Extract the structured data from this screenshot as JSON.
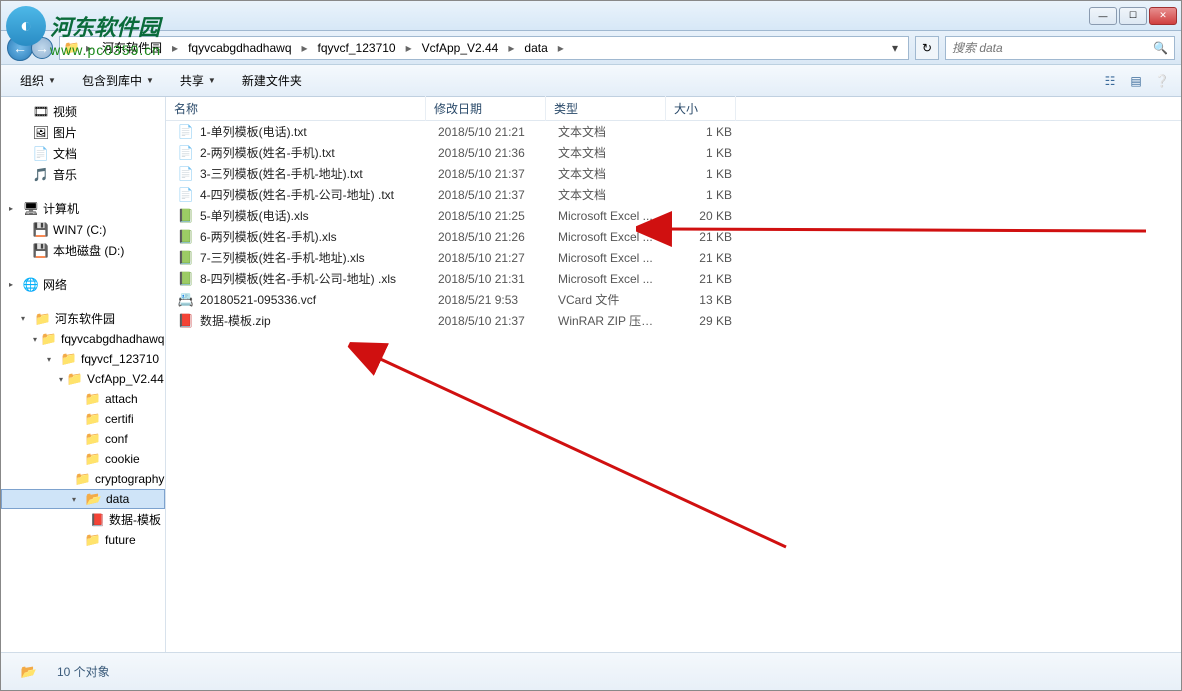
{
  "window": {
    "breadcrumb": [
      {
        "label": "河东软件园"
      },
      {
        "label": "fqyvcabgdhadhawq"
      },
      {
        "label": "fqyvcf_123710"
      },
      {
        "label": "VcfApp_V2.44"
      },
      {
        "label": "data"
      }
    ],
    "search_placeholder": "搜索 data"
  },
  "toolbar": {
    "organize": "组织",
    "include": "包含到库中",
    "share": "共享",
    "new_folder": "新建文件夹"
  },
  "columns": {
    "name": "名称",
    "date": "修改日期",
    "type": "类型",
    "size": "大小"
  },
  "nav": {
    "libraries": [
      {
        "label": "视频",
        "icon": "video-ico"
      },
      {
        "label": "图片",
        "icon": "pic-ico"
      },
      {
        "label": "文档",
        "icon": "doc-ico"
      },
      {
        "label": "音乐",
        "icon": "music-ico"
      }
    ],
    "computer_label": "计算机",
    "drives": [
      {
        "label": "WIN7 (C:)",
        "icon": "drive-ico"
      },
      {
        "label": "本地磁盘 (D:)",
        "icon": "drive-ico"
      }
    ],
    "network_label": "网络",
    "tree": [
      {
        "label": "河东软件园",
        "depth": 0,
        "icon": "folder-ico",
        "tri": "▾"
      },
      {
        "label": "fqyvcabgdhadhawq",
        "depth": 1,
        "icon": "folder-ico",
        "tri": "▾"
      },
      {
        "label": "fqyvcf_123710",
        "depth": 2,
        "icon": "folder-ico",
        "tri": "▾"
      },
      {
        "label": "VcfApp_V2.44",
        "depth": 3,
        "icon": "folder-ico",
        "tri": "▾"
      },
      {
        "label": "attach",
        "depth": 4,
        "icon": "folder-ico",
        "tri": ""
      },
      {
        "label": "certifi",
        "depth": 4,
        "icon": "folder-ico",
        "tri": ""
      },
      {
        "label": "conf",
        "depth": 4,
        "icon": "folder-ico",
        "tri": ""
      },
      {
        "label": "cookie",
        "depth": 4,
        "icon": "folder-ico",
        "tri": ""
      },
      {
        "label": "cryptography",
        "depth": 4,
        "icon": "folder-ico",
        "tri": ""
      },
      {
        "label": "data",
        "depth": 4,
        "icon": "folder-open-ico",
        "tri": "▾",
        "selected": true
      },
      {
        "label": "数据-模板",
        "depth": 5,
        "icon": "arch-ico",
        "tri": ""
      },
      {
        "label": "future",
        "depth": 4,
        "icon": "folder-ico",
        "tri": ""
      }
    ]
  },
  "files": [
    {
      "name": "1-单列模板(电话).txt",
      "date": "2018/5/10 21:21",
      "type": "文本文档",
      "size": "1 KB",
      "icon": "txt-ico"
    },
    {
      "name": "2-两列模板(姓名-手机).txt",
      "date": "2018/5/10 21:36",
      "type": "文本文档",
      "size": "1 KB",
      "icon": "txt-ico"
    },
    {
      "name": "3-三列模板(姓名-手机-地址).txt",
      "date": "2018/5/10 21:37",
      "type": "文本文档",
      "size": "1 KB",
      "icon": "txt-ico"
    },
    {
      "name": "4-四列模板(姓名-手机-公司-地址) .txt",
      "date": "2018/5/10 21:37",
      "type": "文本文档",
      "size": "1 KB",
      "icon": "txt-ico"
    },
    {
      "name": "5-单列模板(电话).xls",
      "date": "2018/5/10 21:25",
      "type": "Microsoft Excel ...",
      "size": "20 KB",
      "icon": "xls-ico"
    },
    {
      "name": "6-两列模板(姓名-手机).xls",
      "date": "2018/5/10 21:26",
      "type": "Microsoft Excel ...",
      "size": "21 KB",
      "icon": "xls-ico"
    },
    {
      "name": "7-三列模板(姓名-手机-地址).xls",
      "date": "2018/5/10 21:27",
      "type": "Microsoft Excel ...",
      "size": "21 KB",
      "icon": "xls-ico"
    },
    {
      "name": "8-四列模板(姓名-手机-公司-地址) .xls",
      "date": "2018/5/10 21:31",
      "type": "Microsoft Excel ...",
      "size": "21 KB",
      "icon": "xls-ico"
    },
    {
      "name": "20180521-095336.vcf",
      "date": "2018/5/21 9:53",
      "type": "VCard 文件",
      "size": "13 KB",
      "icon": "vcf-ico"
    },
    {
      "name": "数据-模板.zip",
      "date": "2018/5/10 21:37",
      "type": "WinRAR ZIP 压缩...",
      "size": "29 KB",
      "icon": "zip-ico"
    }
  ],
  "status": {
    "count": "10 个对象"
  },
  "watermark": {
    "name": "河东软件园",
    "url": "www.pc0359.cn"
  }
}
